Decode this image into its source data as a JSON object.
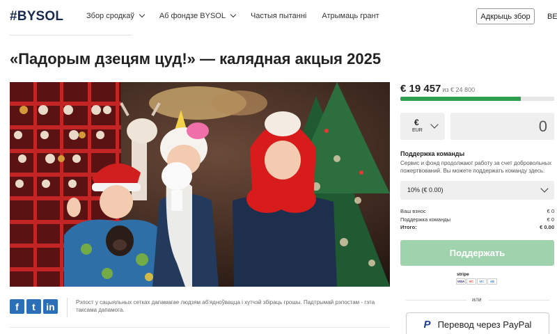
{
  "header": {
    "logo": "#BYSOL",
    "nav": [
      {
        "label": "Збор сродкаў",
        "has_dropdown": true
      },
      {
        "label": "Аб фондзе BYSOL",
        "has_dropdown": true
      },
      {
        "label": "Частыя пытанні",
        "has_dropdown": false
      },
      {
        "label": "Атрымаць грант",
        "has_dropdown": false
      }
    ],
    "create_button": "Адкрыць збор",
    "language": "BE"
  },
  "campaign": {
    "title": "«Падорым дзецям цуд!» — калядная акцыя 2025",
    "photo_alt": "Дзеці ў калядным касцюмах каля ёлкі"
  },
  "share": {
    "icons": [
      "f",
      "t",
      "in"
    ],
    "text": "Рэпост у сацыяльных сетках дапамагае людзям аб'ядноўвацца і хутчэй збіраць грошы. Падтрымай рэпостам - гэта таксама дапамога."
  },
  "donation": {
    "raised": "€ 19 457",
    "goal_text": "из € 24 800",
    "progress_fraction": 0.785,
    "currency_symbol": "€",
    "currency_code": "EUR",
    "amount": "0",
    "support_title": "Поддержка команды",
    "support_desc": "Сервис и фонд продолжают работу за счет добровольных пожертвований. Вы можете поддержать команду здесь:",
    "tip_option": "10% (€ 0.00)",
    "summary": [
      {
        "label": "Ваш взнос",
        "value": "€ 0"
      },
      {
        "label": "Поддержка команды",
        "value": "€ 0"
      },
      {
        "label": "Итого:",
        "value": "€ 0.00"
      }
    ],
    "donate_button": "Поддержать",
    "stripe_label": "stripe",
    "cards": [
      "VISA",
      "MC",
      "MC",
      "AE"
    ],
    "or_text": "или",
    "paypal_button": "Перевод через PayPal"
  },
  "colors": {
    "progress": "#2e9e4f",
    "donate_button": "#9fd3ae",
    "logo": "#1a2a4f",
    "social": "#2b6fb6"
  }
}
